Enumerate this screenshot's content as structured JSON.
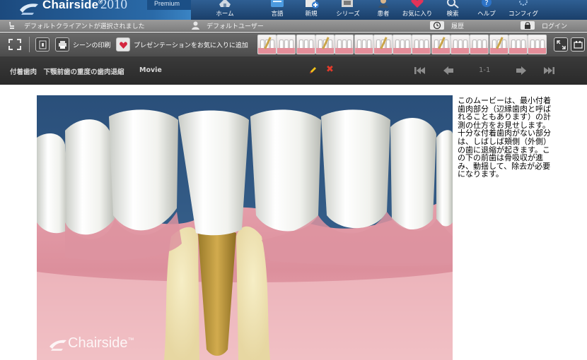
{
  "app": {
    "brand": "Chairside",
    "brand_mark": "®",
    "year": "2010",
    "edition": "Premium"
  },
  "nav": {
    "items": [
      {
        "label": "ホーム",
        "icon": "home-icon"
      },
      {
        "label": "言語",
        "icon": "language-icon"
      },
      {
        "label": "新規",
        "icon": "new-icon"
      },
      {
        "label": "シリーズ",
        "icon": "series-icon"
      },
      {
        "label": "患者",
        "icon": "patient-icon"
      },
      {
        "label": "お気に入り",
        "icon": "favorites-icon"
      },
      {
        "label": "検索",
        "icon": "search-icon"
      },
      {
        "label": "ヘルプ",
        "icon": "help-icon"
      },
      {
        "label": "コンフィグ",
        "icon": "config-icon"
      }
    ]
  },
  "status": {
    "client": "デフォルトクライアントが選択されました",
    "user": "デフォルトユーザー",
    "history": "履歴",
    "login": "ログイン"
  },
  "toolbar": {
    "print_label": "シーンの印刷",
    "favorite_label": "プレゼンテーションをお気に入りに追加",
    "thumbnail_count": 15
  },
  "movie": {
    "title": "付着歯肉　下顎前歯の重度の歯肉退縮",
    "type": "Movie",
    "page": "1-1"
  },
  "video": {
    "watermark": "Chairside",
    "watermark_mark": "™"
  },
  "description": "このムービーは、最小付着歯肉部分（辺縁歯肉と呼ばれることもあります）の計測の仕方をお見せします。十分な付着歯肉がない部分は、しばしば頬側（外側）の歯に退縮が起きます。この下の前歯は骨吸収が進み、動揺して、除去が必要になります。",
  "colors": {
    "header_blue": "#1a3f6a",
    "toolbar_gray": "#4c4c4c",
    "gum_pink": "#d98c98",
    "delete_red": "#e23a2a",
    "edit_yellow": "#f2c21a"
  }
}
